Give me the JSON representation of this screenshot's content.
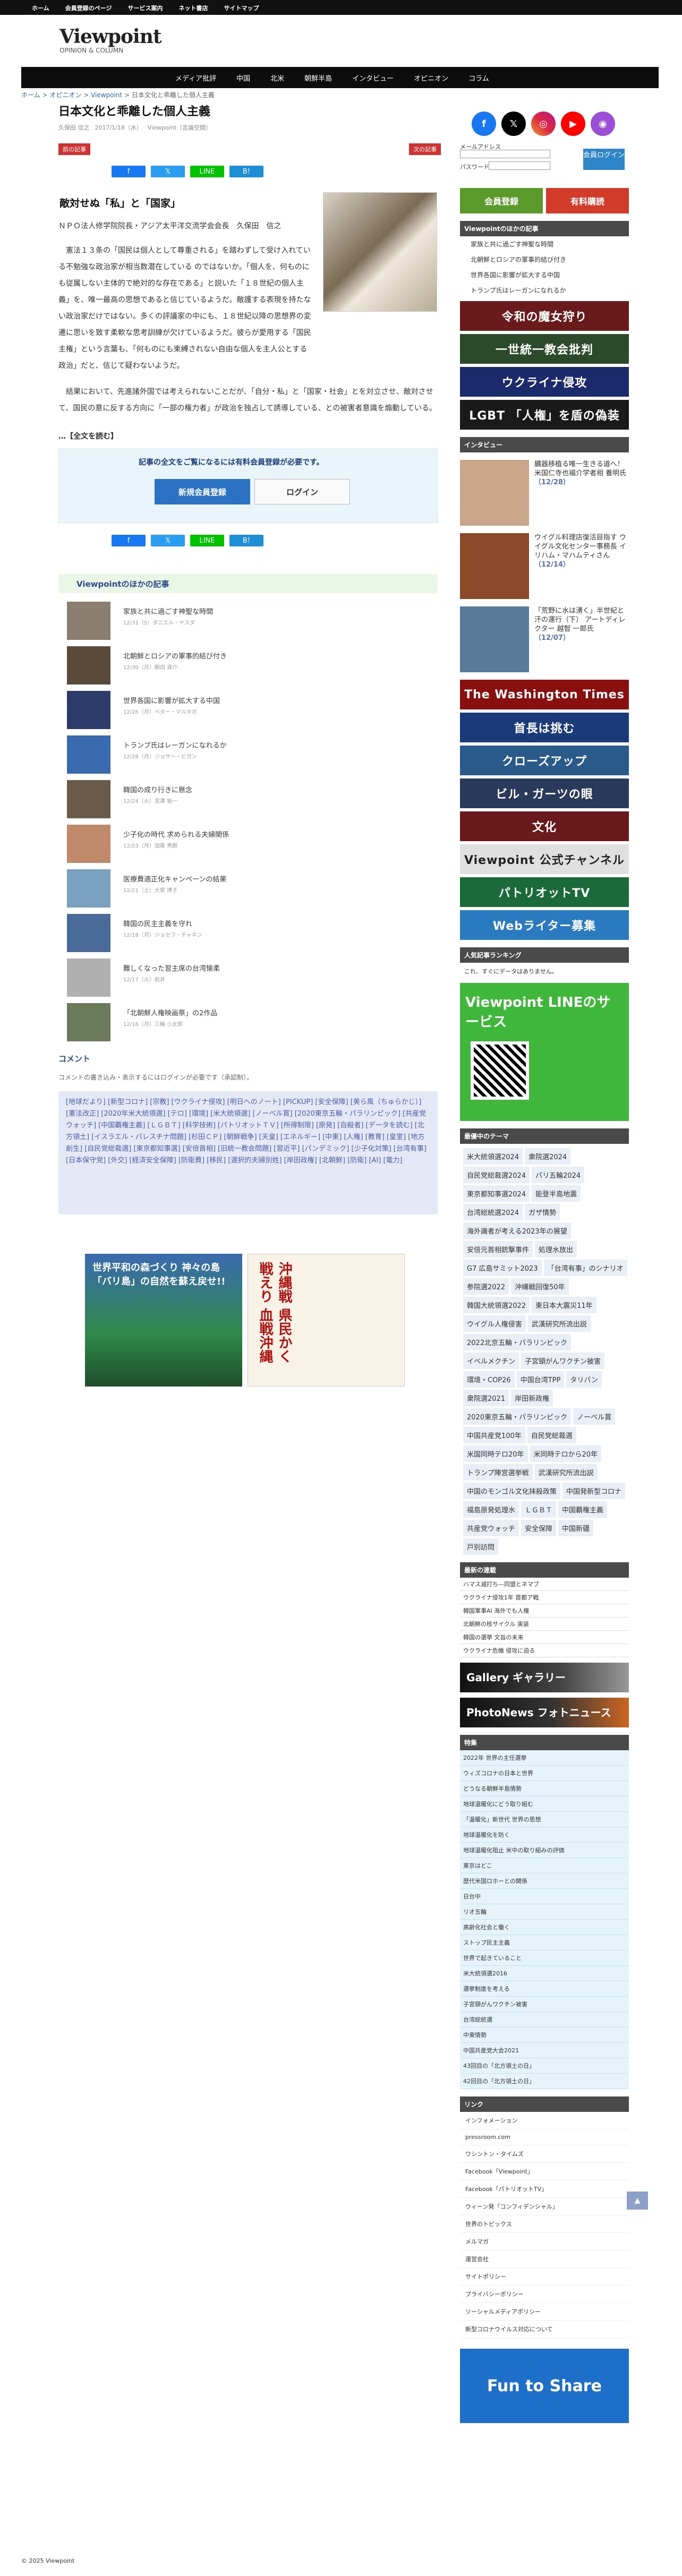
{
  "top": {
    "links": [
      "ホーム",
      "会員登録のページ",
      "サービス案内",
      "ネット書店",
      "サイトマップ"
    ]
  },
  "logo": {
    "title": "Viewpoint",
    "sub": "OPINION & COLUMN"
  },
  "gnav": [
    "メディア批評",
    "中国",
    "北米",
    "朝鮮半島",
    "インタビュー",
    "オピニオン",
    "コラム"
  ],
  "crumb": {
    "home": "ホーム",
    "c1": "オピニオン",
    "c2": "Viewpoint",
    "cur": "日本文化と乖離した個人主義"
  },
  "article": {
    "title": "日本文化と乖離した個人主義",
    "author": "久保田 信之",
    "date": "2017/1/18（水）",
    "cat": "Viewpoint（言論空間）",
    "prev": "前の記事",
    "next": "次の記事",
    "heading": "敵対せぬ「私」と「国家」",
    "affil": "ＮＰＯ法人修学院院長・アジア太平洋交流学会会長　久保田　信之",
    "p1": "憲法１３条の「国民は個人として尊重される」を踏わずして受け入れている不勉強な政治家が相当数潜在している のではないか。「個人を、何ものにも従属しない主体的で絶対的な存在である」と説いた「１８世紀の個人主義」を、唯一最高の思想であると信じているようだ。敵護する表現を持たない政治家だけではない。多くの評議家の中にも、１８世紀以降の思想界の変遷に思いを致す柔軟な思考訓練が欠けているようだ。彼らが愛用する「国民主権」という言葉も、「何ものにも束縛されない自由な個人を主人公とする政治」だと、信じて疑わないようだ。",
    "p2": "結果において、先進諸外国では考えられないことだが、「自分・私」と「国家・社会」とを対立させ、敵対させて、国民の意に反する方向に「一部の権力者」が政治を独占して誘導している、との被害者意識を煽動している。",
    "full": "…【全文を読む】",
    "paytext": "記事の全文をご覧になるには有料会員登録が必要です。",
    "register": "新規会員登録",
    "login": "ログイン",
    "share": [
      "f",
      "𝕏",
      "B!",
      "LINE"
    ]
  },
  "related": {
    "head": "Viewpointのほかの記事",
    "items": [
      {
        "t": "家族と共に過ごす神聖な時間",
        "d": "12/31（S）ダニエル・ヤスダ"
      },
      {
        "t": "北朝鮮とロシアの軍事的結び付き",
        "d": "12/30（月）朝田 満介"
      },
      {
        "t": "世界各国に影響が拡大する中国",
        "d": "12/26（月）ペター・マルタボ"
      },
      {
        "t": "トランプ氏はレーガンになれるか",
        "d": "12/26（月）ジョサー・ビガン"
      },
      {
        "t": "韓国の成り行きに懸念",
        "d": "12/24（火）宮澤 裕一"
      },
      {
        "t": "少子化の時代 求められる夫婦関係",
        "d": "12/23（月）加藤 秀朗"
      },
      {
        "t": "医療費適正化キャンペーンの結果",
        "d": "12/21（土）大家 博子"
      },
      {
        "t": "韓国の民主主義を守れ",
        "d": "12/18（月）ジョセフ・チャネン"
      },
      {
        "t": "難しくなった習主席の台湾懐柔",
        "d": "12/17（火）岩井"
      },
      {
        "t": "「北朝鮮人権映画祭」の2作品",
        "d": "12/16（月）三輪 小太郎"
      }
    ]
  },
  "comments": {
    "head": "コメント",
    "text": "コメントの書き込み・表示するにはログインが必要です（承認制）。"
  },
  "tags": "[地球だより] [新型コロナ] [宗教] [ウクライナ侵攻] [明日へのノート] [PICKUP] [安全保障] [美ら風（ちゅらかじ）] [憲法改正] [2020年米大統領選] [テロ] [環境] [米大統領選] [ノーベル賞] [2020東京五輪・パラリンピック] [共産党ウォッチ] [中国覇権主義] [ＬＧＢＴ] [科学技術] [パトリオットＴＶ] [所得制限] [原発] [自殺者] [データを読む] [北方領土] [イスラエル・パレスチナ問題] [杉田ＣＰ] [朝鮮戦争] [天皇] [エネルギー] [中東] [人権] [教育] [皇室] [地方創生] [自民党総裁選] [東京都知事選] [安倍首相] [旧統一教会問題] [習近平] [パンデミック] [少子化対策] [台湾有事] [日本保守党] [外交] [経済安全保障] [防衛費] [移民] [選択的夫婦別姓] [岸田政権] [北朝鮮] [防衛] [AI] [電力]",
  "banners": {
    "b1": "世界平和の森づくり 神々の島「バリ島」の自然を蘇え戻せ!!",
    "b2": "沖縄戦 県民かく戦えり 血戦沖縄"
  },
  "side": {
    "sns": [
      "f",
      "𝕏",
      "◎",
      "▶",
      "◉"
    ],
    "mail": "メールアドレス",
    "pass": "パスワード",
    "loginbtn": "会員ログイン",
    "member": "会員登録",
    "paid": "有料購読",
    "vpother": "Viewpointのほかの記事",
    "vplist": [
      "家族と共に過ごす神聖な時間",
      "北朝鮮とロシアの軍事的結び付き",
      "世界各国に影響が拡大する中国",
      "トランプ氏はレーガンになれるか"
    ],
    "sban": [
      "令和の魔女狩り",
      "一世統一教会批判",
      "ウクライナ侵攻",
      "LGBT 「人権」を盾の偽装"
    ],
    "interview": "インタビュー",
    "iv": [
      {
        "t": "臓器移植る唯一生きる道へ！米国仁寺也福介学者相 養明氏",
        "d": "（12/28）"
      },
      {
        "t": "ウイグル料理店復活目指す ウイグル文化センター事務長 イリハム・マハムティさん",
        "d": "（12/14）"
      },
      {
        "t": "「荒野に水は湧く」半世紀と汗の運行（下） アートディレクター 越智 一郎氏",
        "d": "（12/07）"
      }
    ],
    "sban2": [
      "The Washington Times",
      "首長は挑む",
      "クローズアップ",
      "ビル・ガーツの眼",
      "文化",
      "Viewpoint 公式チャンネル",
      "パトリオットTV",
      "Webライター募集"
    ],
    "rank": "人気記事ランキング",
    "ranktxt": "これ、すぐにデータはありません。",
    "line": "Viewpoint LINEのサービス",
    "theme": "最優中のテーマ",
    "themes": [
      "米大統領選2024",
      "衆院選2024",
      "自民党総裁選2024",
      "パリ五輪2024",
      "東京都知事選2024",
      "能登半島地震",
      "台湾総統選2024",
      "ガザ情勢",
      "海外識者が考える2023年の展望",
      "安倍元首相銃撃事件",
      "処理水放出",
      "G7 広島サミット2023",
      "「台湾有事」のシナリオ",
      "参院選2022",
      "沖縄戦回復50年",
      "韓国大統領選2022",
      "東日本大震災11年",
      "ウイグル人権侵害",
      "武漢研究所流出説",
      "2022北京五輪・パラリンピック",
      "イベルメクチン",
      "子宮頸がんワクチン被害",
      "環境・COP26",
      "中国台湾TPP",
      "タリバン",
      "衆院選2021",
      "岸田新政権",
      "2020東京五輪・パラリンピック",
      "ノーベル賞",
      "中国共産党100年",
      "自民党総裁選",
      "米国同時テロ20年",
      "米同時テロから20年",
      "トランプ陣営選挙戦",
      "武漢研究所流出説",
      "中国のモンゴル文化抹殺政策",
      "中国発新型コロナ",
      "福島原発処理水",
      "ＬＧＢＴ",
      "中国覇権主義",
      "共産党ウォッチ",
      "安全保障",
      "中国新疆",
      "戸別訪問"
    ],
    "newshead": "最新の連載",
    "news": [
      "ハマス滅打ち—同盟とネマブ",
      "ウクライナ侵攻1年 首都ア戦",
      "韓国軍事AI 海外でも人権",
      "北朝鮮の核サイクル 実装",
      "韓国の選挙 文旨の未来",
      "ウクライナ危機 侵攻に迫る"
    ],
    "gallery": "Gallery ギャラリー",
    "photo": "PhotoNews フォトニュース",
    "toku": "特集",
    "tokulist": [
      "2022年 世界の主任選挙",
      "ウィズコロナの日本と世界",
      "どうなる朝鮮半島情勢",
      "地球温暖化にどう取り組む",
      "「温暖化」新世代 世界の思想",
      "地球温暖化を防く",
      "地球温暖化阻止 米中の取り組みの評価",
      "東京はどこ",
      "歴代米国ロホーとの関係",
      "日台中",
      "リオ五輪",
      "高齢化社会と働く",
      "ストップ民主主義",
      "世界で起きていること",
      "米大統領選2016",
      "選挙制度を考える",
      "子宮頸がんワクチン被害",
      "台湾総統選",
      "中東情勢",
      "中国共産党大会2021",
      "43回目の「北方領土の日」",
      "42回目の「北方領土の日」"
    ],
    "linkhead": "リンク",
    "links": [
      "インフォメーション",
      "pressroom.com",
      "ワシントン・タイムズ",
      "Facebook「Viewpoint」",
      "Facebook「パトリオットTV」",
      "ウィーン発「コンフィデンシャル」",
      "世界のトピックス",
      "メルマガ",
      "運営会社",
      "サイトポリシー",
      "プライバシーポリシー",
      "ソーシャルメディアポリシー",
      "新型コロナウイルス対応について"
    ],
    "fun": "Fun to Share"
  },
  "footer": "© 2025 Viewpoint"
}
